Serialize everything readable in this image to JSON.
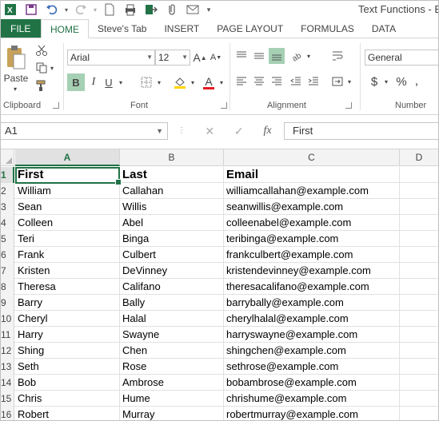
{
  "window": {
    "title": "Text Functions - Ex"
  },
  "qat": {
    "icons": [
      "excel-logo-icon",
      "save-icon",
      "undo-icon",
      "redo-icon",
      "new-file-icon",
      "quick-print-icon",
      "export-icon",
      "attach-icon",
      "email-icon"
    ]
  },
  "ribbon_tabs": [
    "FILE",
    "HOME",
    "Steve's Tab",
    "INSERT",
    "PAGE LAYOUT",
    "FORMULAS",
    "DATA"
  ],
  "active_tab": "HOME",
  "ribbon": {
    "clipboard": {
      "label": "Clipboard",
      "paste_label": "Paste"
    },
    "font": {
      "label": "Font",
      "font_name": "Arial",
      "font_size": "12",
      "bold": "B",
      "italic": "I",
      "underline": "U",
      "grow": "A",
      "shrink": "A",
      "font_color_glyph": "A",
      "font_color": "#e51c23",
      "fill_color": "#ffd400"
    },
    "alignment": {
      "label": "Alignment"
    },
    "number": {
      "label": "Number",
      "format": "General",
      "currency": "$",
      "percent": "%"
    }
  },
  "formula_bar": {
    "name_box": "A1",
    "cancel": "✕",
    "enter": "✓",
    "fx": "fx",
    "value": "First"
  },
  "sheet": {
    "columns": [
      "A",
      "B",
      "C",
      "D"
    ],
    "selected_column": "A",
    "selected_row": "1",
    "rows": [
      {
        "n": "1",
        "cells": [
          "First",
          "Last",
          "Email"
        ],
        "header": true
      },
      {
        "n": "2",
        "cells": [
          "William",
          "Callahan",
          "williamcallahan@example.com"
        ]
      },
      {
        "n": "3",
        "cells": [
          "Sean",
          "Willis",
          "seanwillis@example.com"
        ]
      },
      {
        "n": "4",
        "cells": [
          "Colleen",
          "Abel",
          "colleenabel@example.com"
        ]
      },
      {
        "n": "5",
        "cells": [
          "Teri",
          "Binga",
          "teribinga@example.com"
        ]
      },
      {
        "n": "6",
        "cells": [
          "Frank",
          "Culbert",
          "frankculbert@example.com"
        ]
      },
      {
        "n": "7",
        "cells": [
          "Kristen",
          "DeVinney",
          "kristendevinney@example.com"
        ]
      },
      {
        "n": "8",
        "cells": [
          "Theresa",
          "Califano",
          "theresacalifano@example.com"
        ]
      },
      {
        "n": "9",
        "cells": [
          "Barry",
          "Bally",
          "barrybally@example.com"
        ]
      },
      {
        "n": "10",
        "cells": [
          "Cheryl",
          "Halal",
          "cherylhalal@example.com"
        ]
      },
      {
        "n": "11",
        "cells": [
          "Harry",
          "Swayne",
          "harryswayne@example.com"
        ]
      },
      {
        "n": "12",
        "cells": [
          "Shing",
          "Chen",
          "shingchen@example.com"
        ]
      },
      {
        "n": "13",
        "cells": [
          "Seth",
          "Rose",
          "sethrose@example.com"
        ]
      },
      {
        "n": "14",
        "cells": [
          "Bob",
          "Ambrose",
          "bobambrose@example.com"
        ]
      },
      {
        "n": "15",
        "cells": [
          "Chris",
          "Hume",
          "chrishume@example.com"
        ]
      },
      {
        "n": "16",
        "cells": [
          "Robert",
          "Murray",
          "robertmurray@example.com"
        ]
      }
    ]
  },
  "colors": {
    "accent": "#217346",
    "selected_header": "#e1e1e1"
  }
}
